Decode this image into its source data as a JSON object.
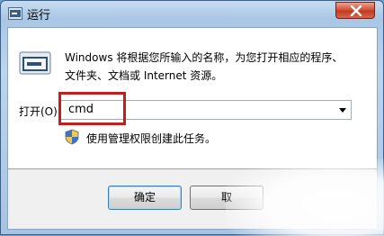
{
  "window": {
    "title": "运行"
  },
  "description": {
    "line1": "Windows 将根据您所输入的名称，为您打开相应的程序、",
    "line2": "文件夹、文档或 Internet 资源。"
  },
  "open_field": {
    "label": "打开(O):",
    "value": "cmd"
  },
  "admin_note": "使用管理权限创建此任务。",
  "buttons": {
    "ok": "确定",
    "cancel": "取"
  },
  "icons": [
    "run-app-icon",
    "run-program-icon",
    "dropdown-arrow-icon",
    "uac-shield-icon",
    "close-icon"
  ],
  "colors": {
    "highlight_box": "#c21e1e",
    "close_button": "#c94a33"
  }
}
